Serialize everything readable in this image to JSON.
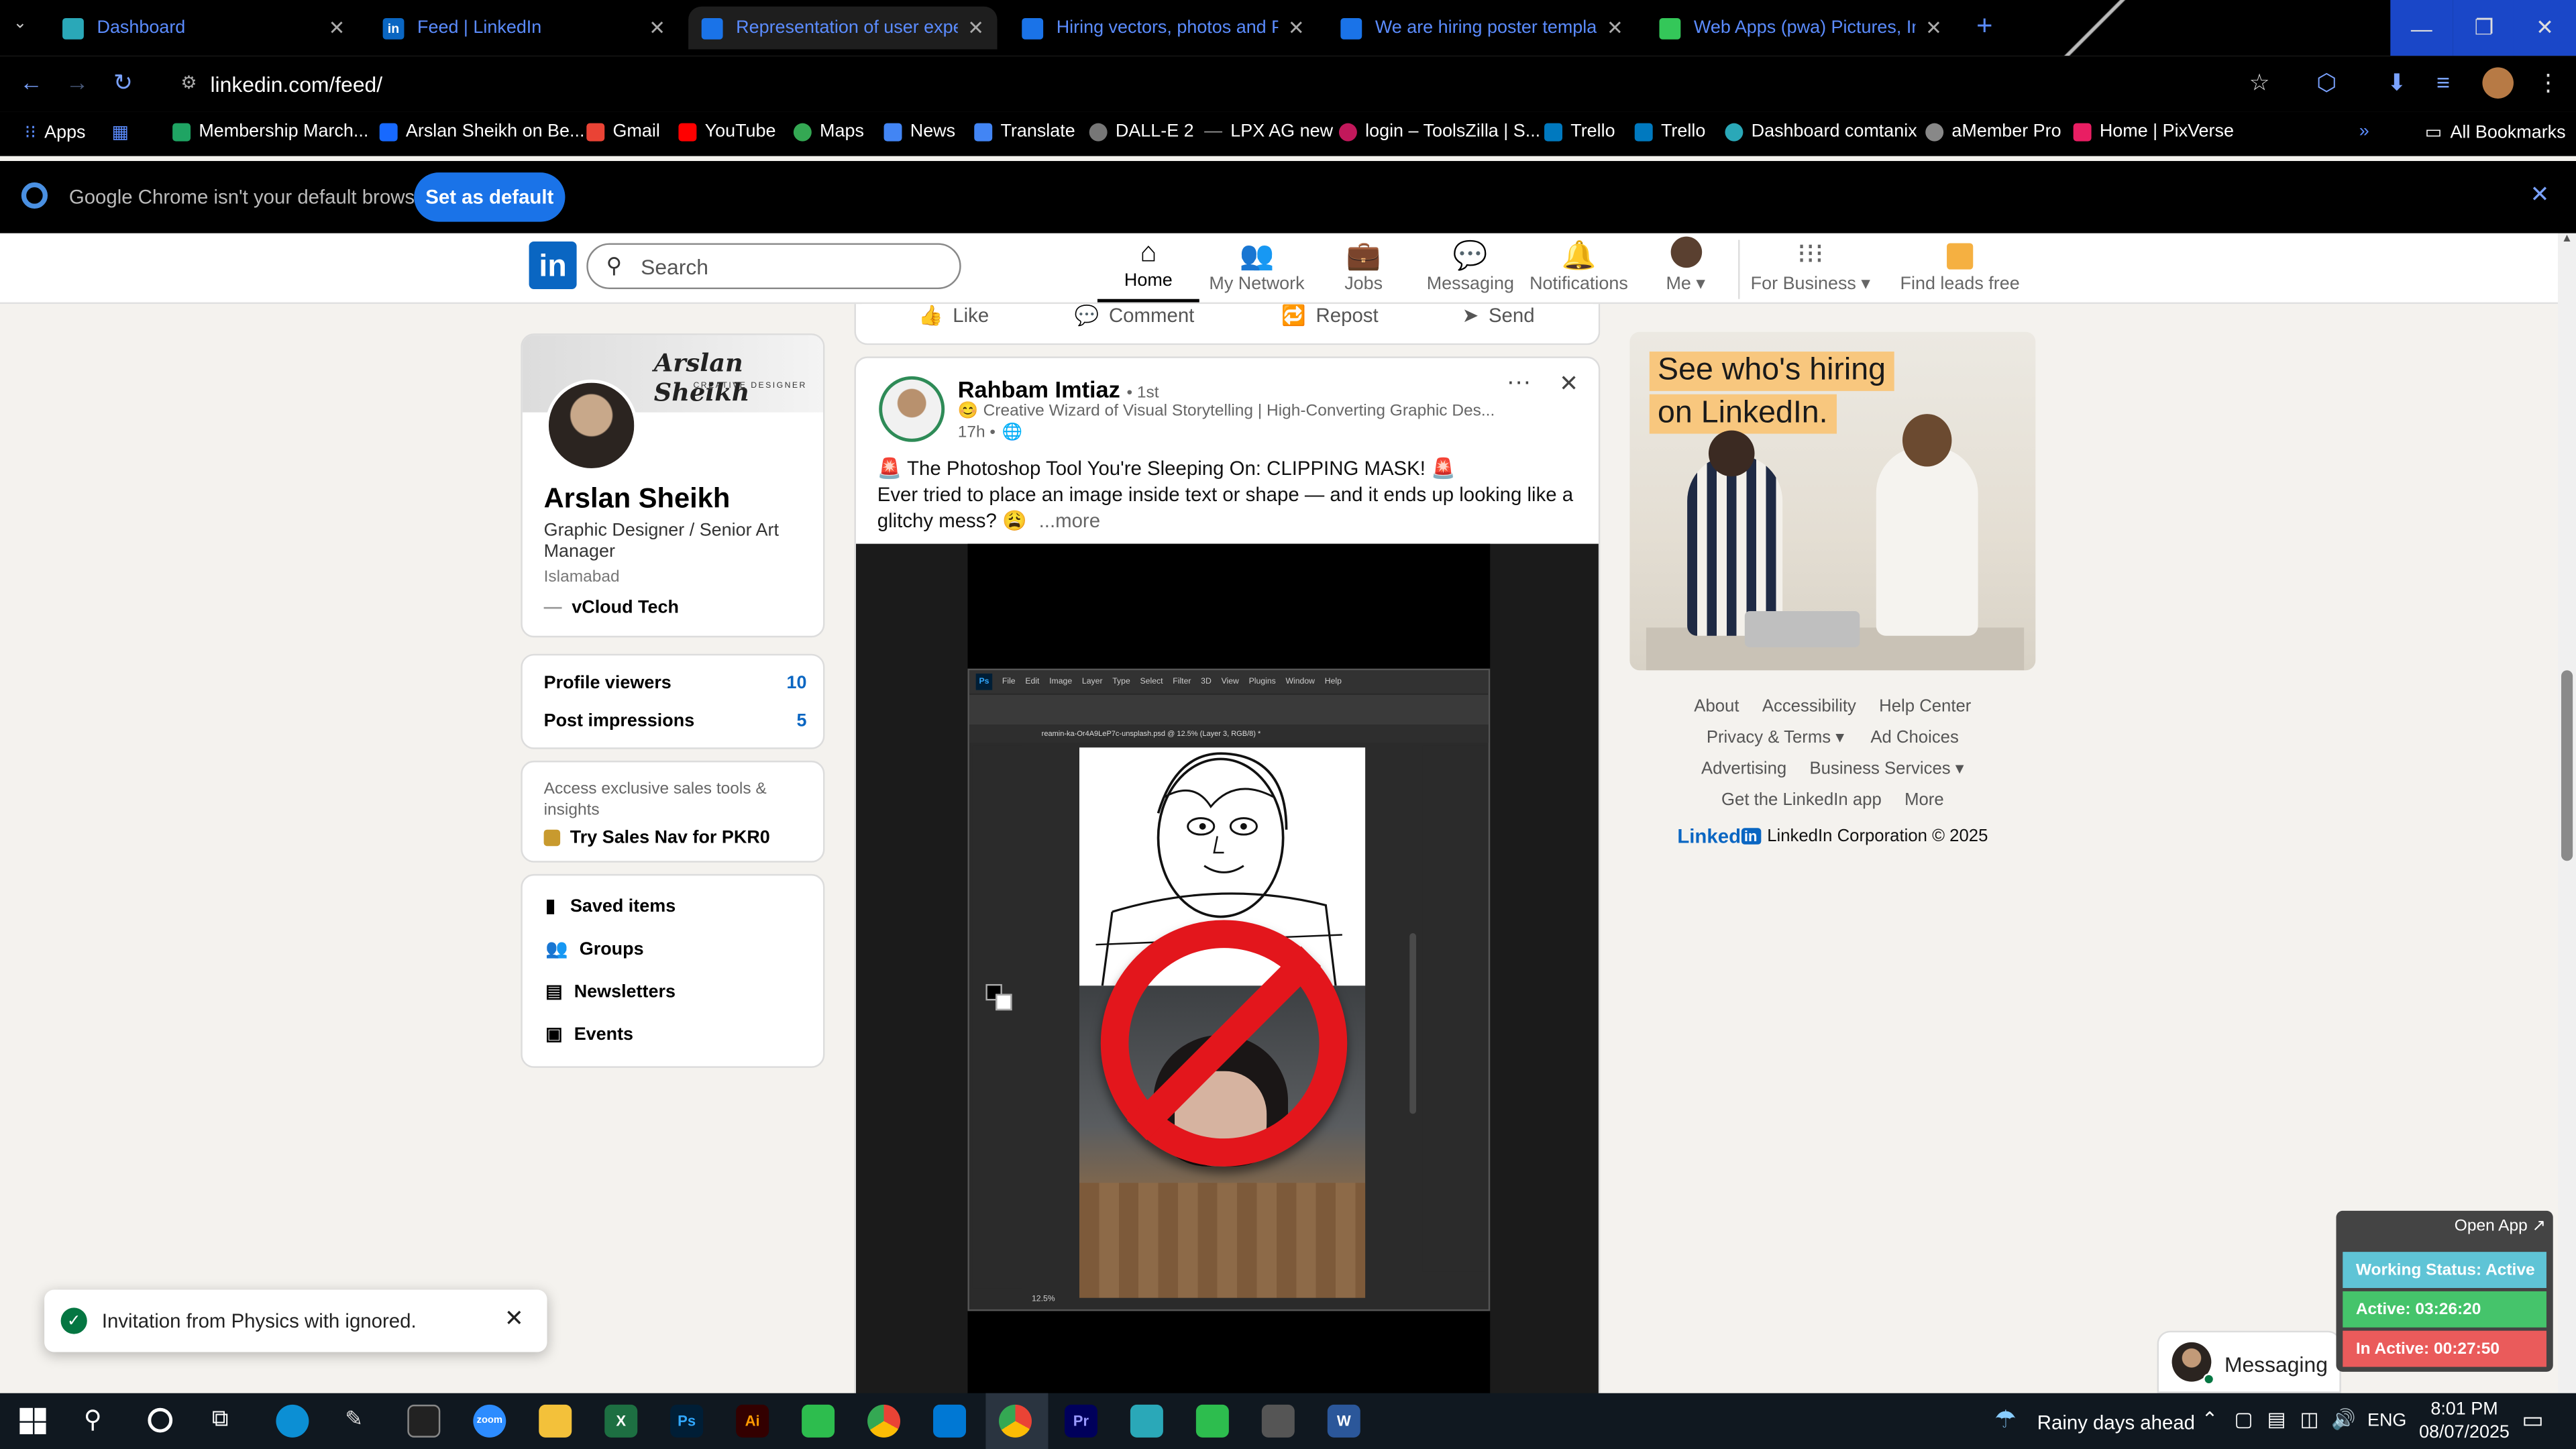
{
  "browser": {
    "tabs": [
      {
        "title": "Dashboard",
        "icon_color": "#2aa8b8"
      },
      {
        "title": "Feed | LinkedIn",
        "icon_color": "#0a66c2"
      },
      {
        "title": "Representation of user experie",
        "icon_color": "#1a73e8"
      },
      {
        "title": "Hiring vectors, photos and PSD",
        "icon_color": "#1a73e8"
      },
      {
        "title": "We are hiring poster template |",
        "icon_color": "#1a73e8"
      },
      {
        "title": "Web Apps (pwa) Pictures, Imag",
        "icon_color": "#34c759"
      }
    ],
    "url": "linkedin.com/feed/",
    "bookmarks": [
      {
        "label": "Apps"
      },
      {
        "label": "Membership March..."
      },
      {
        "label": "Arslan Sheikh on Be..."
      },
      {
        "label": "Gmail"
      },
      {
        "label": "YouTube"
      },
      {
        "label": "Maps"
      },
      {
        "label": "News"
      },
      {
        "label": "Translate"
      },
      {
        "label": "DALL-E 2"
      },
      {
        "label": "LPX AG new"
      },
      {
        "label": "login – ToolsZilla | S..."
      },
      {
        "label": "Trello"
      },
      {
        "label": "Trello"
      },
      {
        "label": "Dashboard comtanix"
      },
      {
        "label": "aMember Pro"
      },
      {
        "label": "Home | PixVerse"
      }
    ],
    "all_bookmarks": "All Bookmarks",
    "default_msg": "Google Chrome isn't your default browser",
    "set_default": "Set as default"
  },
  "linkedin": {
    "logo": "in",
    "search_placeholder": "Search",
    "nav": [
      {
        "label": "Home",
        "icon": "home-icon"
      },
      {
        "label": "My Network",
        "icon": "network-icon"
      },
      {
        "label": "Jobs",
        "icon": "briefcase-icon"
      },
      {
        "label": "Messaging",
        "icon": "chat-icon"
      },
      {
        "label": "Notifications",
        "icon": "bell-icon"
      },
      {
        "label": "Me ▾",
        "icon": "avatar"
      },
      {
        "label": "For Business ▾",
        "icon": "grid-icon"
      },
      {
        "label": "Find leads free",
        "icon": "leads-icon"
      }
    ]
  },
  "profile": {
    "banner_text": "Arslan Sheikh",
    "banner_sub": "CREATIVE DESIGNER",
    "name": "Arslan Sheikh",
    "headline": "Graphic Designer / Senior Art Manager",
    "location": "Islamabad",
    "company": "vCloud Tech",
    "stats": [
      {
        "label": "Profile viewers",
        "value": "10"
      },
      {
        "label": "Post impressions",
        "value": "5"
      }
    ],
    "premium_text": "Access exclusive sales tools & insights",
    "premium_link": "Try Sales Nav for PKR0",
    "links": [
      "Saved items",
      "Groups",
      "Newsletters",
      "Events"
    ]
  },
  "feed": {
    "actions": [
      "Like",
      "Comment",
      "Repost",
      "Send"
    ],
    "post": {
      "author": "Rahbam Imtiaz",
      "degree": "• 1st",
      "headline": "Creative Wizard of Visual Storytelling | High-Converting Graphic Des...",
      "time": "17h •",
      "title": "The Photoshop Tool You're Sleeping On: CLIPPING MASK!",
      "body": "Ever tried to place an image inside text or shape — and it ends up looking like a glitchy mess?",
      "more": "...more",
      "ps_menu": [
        "File",
        "Edit",
        "Image",
        "Layer",
        "Type",
        "Select",
        "Filter",
        "3D",
        "View",
        "Plugins",
        "Window",
        "Help"
      ],
      "ps_doc_tab": "reamin-ka-Or4A9LeP7c-unsplash.psd @ 12.5% (Layer 3, RGB/8) *",
      "ps_zoom": "12.5%"
    }
  },
  "ad": {
    "line1": "See who's hiring",
    "line2": "on LinkedIn."
  },
  "footer": {
    "links": [
      "About",
      "Accessibility",
      "Help Center",
      "Privacy & Terms ▾",
      "Ad Choices",
      "Advertising",
      "Business Services ▾",
      "Get the LinkedIn app",
      "More"
    ],
    "brand": "Linked",
    "copyright": "LinkedIn Corporation © 2025"
  },
  "toast": {
    "message": "Invitation from Physics with ignored."
  },
  "messaging": {
    "label": "Messaging"
  },
  "tracker": {
    "open_app": "Open App ↗",
    "working": "Working Status: Active",
    "active": "Active: 03:26:20",
    "inactive": "In Active: 00:27:50"
  },
  "taskbar": {
    "weather": "Rainy days ahead",
    "lang": "ENG",
    "time": "8:01 PM",
    "date": "08/07/2025"
  }
}
